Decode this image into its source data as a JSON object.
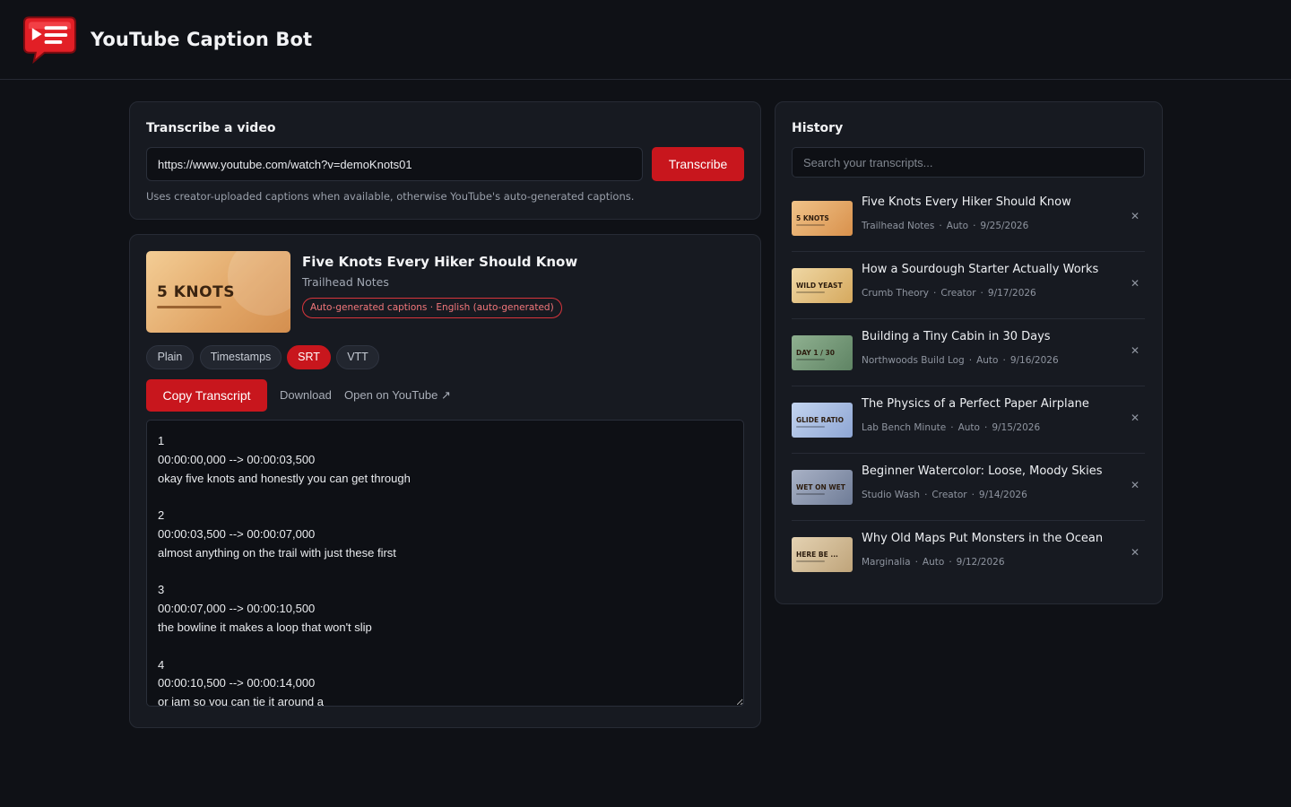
{
  "app": {
    "title": "YouTube Caption Bot",
    "logo_icon": "speech-bubble-logo"
  },
  "transcribe": {
    "heading": "Transcribe a video",
    "url_value": "https://www.youtube.com/watch?v=demoKnots01",
    "button_label": "Transcribe",
    "hint": "Uses creator-uploaded captions when available, otherwise YouTube's auto-generated captions."
  },
  "result": {
    "thumb_text": "5 KNOTS",
    "title": "Five Knots Every Hiker Should Know",
    "channel": "Trailhead Notes",
    "caption_badge": "Auto-generated captions · English (auto-generated)",
    "formats": [
      {
        "label": "Plain",
        "active": false
      },
      {
        "label": "Timestamps",
        "active": false
      },
      {
        "label": "SRT",
        "active": true
      },
      {
        "label": "VTT",
        "active": false
      }
    ],
    "copy_label": "Copy Transcript",
    "download_label": "Download",
    "open_label": "Open on YouTube ↗",
    "transcript": "1\n00:00:00,000 --> 00:00:03,500\nokay five knots and honestly you can get through\n\n2\n00:00:03,500 --> 00:00:07,000\nalmost anything on the trail with just these first\n\n3\n00:00:07,000 --> 00:00:10,500\nthe bowline it makes a loop that won't slip\n\n4\n00:00:10,500 --> 00:00:14,000\nor iam so vou can tie it around a"
  },
  "history": {
    "heading": "History",
    "search_placeholder": "Search your transcripts...",
    "items": [
      {
        "title": "Five Knots Every Hiker Should Know",
        "channel": "Trailhead Notes",
        "source": "Auto",
        "date": "9/25/2026",
        "thumb_text": "5 KNOTS",
        "thumb_colors": [
          "#f0c389",
          "#d9914c"
        ]
      },
      {
        "title": "How a Sourdough Starter Actually Works",
        "channel": "Crumb Theory",
        "source": "Creator",
        "date": "9/17/2026",
        "thumb_text": "WILD YEAST",
        "thumb_colors": [
          "#efd7a4",
          "#d6a95e"
        ]
      },
      {
        "title": "Building a Tiny Cabin in 30 Days",
        "channel": "Northwoods Build Log",
        "source": "Auto",
        "date": "9/16/2026",
        "thumb_text": "DAY 1 / 30",
        "thumb_colors": [
          "#8fb090",
          "#5f8464"
        ]
      },
      {
        "title": "The Physics of a Perfect Paper Airplane",
        "channel": "Lab Bench Minute",
        "source": "Auto",
        "date": "9/15/2026",
        "thumb_text": "GLIDE RATIO",
        "thumb_colors": [
          "#c3d4ef",
          "#8ea6d4"
        ]
      },
      {
        "title": "Beginner Watercolor: Loose, Moody Skies",
        "channel": "Studio Wash",
        "source": "Creator",
        "date": "9/14/2026",
        "thumb_text": "WET ON WET",
        "thumb_colors": [
          "#a9b2c6",
          "#6f7c97"
        ]
      },
      {
        "title": "Why Old Maps Put Monsters in the Ocean",
        "channel": "Marginalia",
        "source": "Auto",
        "date": "9/12/2026",
        "thumb_text": "HERE BE ...",
        "thumb_colors": [
          "#e4d2b2",
          "#bfa47a"
        ]
      }
    ],
    "close_icon": "close-icon",
    "meta_separator": "·"
  },
  "colors": {
    "accent": "#c8161d",
    "background": "#0f1116",
    "card": "#171a21"
  }
}
